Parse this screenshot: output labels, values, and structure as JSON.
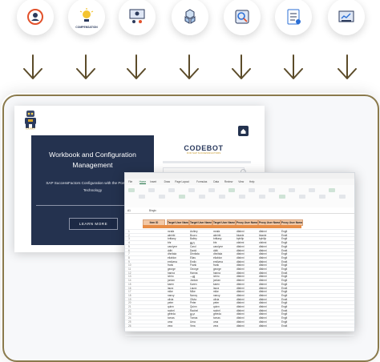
{
  "top_icons": [
    {
      "icon": "employee-profile-icon",
      "label": ""
    },
    {
      "icon": "compensation-icon",
      "label": "COMPENSATION"
    },
    {
      "icon": "team-management-icon",
      "label": ""
    },
    {
      "icon": "modules-cubes-icon",
      "label": ""
    },
    {
      "icon": "recruiting-search-icon",
      "label": ""
    },
    {
      "icon": "form-checklist-icon",
      "label": ""
    },
    {
      "icon": "analytics-dashboard-icon",
      "label": ""
    }
  ],
  "colors": {
    "navy": "#24324f",
    "gold": "#8a7a4c",
    "header_orange": "#f2c8a6",
    "excel_green": "#217346"
  },
  "card": {
    "title_line1": "Workbook and Configuration",
    "title_line2": "Management",
    "subtitle_line1": "SAP SuccessFactors Configuration with the Power of Bot",
    "subtitle_line2": "Technology",
    "button_label": "LEARN MORE"
  },
  "codebot": {
    "name": "CODEBOT",
    "tagline": "FOR SAP SUCCESSFACTORS"
  },
  "excel": {
    "tabs": [
      "File",
      "Home",
      "Insert",
      "Draw",
      "Page Layout",
      "Formulas",
      "Data",
      "Review",
      "View",
      "Help"
    ],
    "formula_ref": "A1",
    "formula_value": "Bingin",
    "headers": [
      "Item ID",
      "Target User Name",
      "Target User Name",
      "Target User Name",
      "Proxy User Name",
      "Proxy User Name",
      "Proxy User Name"
    ],
    "rows": [
      [
        "1",
        "mrafa",
        "Ashley",
        "mrafa",
        "dfahmi",
        "dfahmi",
        "Englt"
      ],
      [
        "2",
        "almirbi",
        "Bouru",
        "almirbi",
        "bkanie",
        "bkanie",
        "Englt"
      ],
      [
        "3",
        "brittany",
        "Bailey",
        "brittany",
        "bphilip",
        "bphilip",
        "Englt"
      ],
      [
        "4",
        "bhr",
        "暁介",
        "bhr",
        "cfahmi",
        "cfahmi",
        "Englt"
      ],
      [
        "5",
        "carolyne",
        "Carol",
        "carolyne",
        "dfahmi",
        "dfahmi",
        "Englt"
      ],
      [
        "6",
        "ddhi",
        "David",
        "ddhi",
        "dfahmi",
        "dfahmi",
        "Englt"
      ],
      [
        "7",
        "dhnitala",
        "Dhnitala",
        "dhnitala",
        "dfahmi",
        "dfahmi",
        "Englt"
      ],
      [
        "8",
        "eliablon",
        "Elias",
        "eliablon",
        "dfahmi",
        "dfahmi",
        "Englt"
      ],
      [
        "9",
        "emilyma",
        "Emily",
        "emilyma",
        "dfahmi",
        "dfahmi",
        "Englt"
      ],
      [
        "10",
        "frank",
        "Frank",
        "frank",
        "dfahmi",
        "dfahmi",
        "Englt"
      ],
      [
        "11",
        "george",
        "George",
        "george",
        "dfahmi",
        "dfahmi",
        "Englt"
      ],
      [
        "12",
        "hanna",
        "Hanna",
        "hanna",
        "dfahmi",
        "dfahmi",
        "Englt"
      ],
      [
        "13",
        "ichiro",
        "一郎",
        "ichiro",
        "dfahmi",
        "dfahmi",
        "Englt"
      ],
      [
        "14",
        "jordan",
        "Jordan",
        "jordan",
        "dfahmi",
        "dfahmi",
        "Englt"
      ],
      [
        "15",
        "karen",
        "Karen",
        "karen",
        "dfahmi",
        "dfahmi",
        "Englt"
      ],
      [
        "16",
        "laura",
        "Laura",
        "laura",
        "dfahmi",
        "dfahmi",
        "Englt"
      ],
      [
        "17",
        "mike",
        "Mike",
        "mike",
        "dfahmi",
        "dfahmi",
        "Englt"
      ],
      [
        "18",
        "nancy",
        "Nancy",
        "nancy",
        "dfahmi",
        "dfahmi",
        "Englt"
      ],
      [
        "19",
        "olivia",
        "Olivia",
        "olivia",
        "dfahmi",
        "dfahmi",
        "Englt"
      ],
      [
        "20",
        "peter",
        "Peter",
        "peter",
        "dfahmi",
        "dfahmi",
        "Englt"
      ],
      [
        "21",
        "quinn",
        "Quinn",
        "quinn",
        "dfahmi",
        "dfahmi",
        "Englt"
      ],
      [
        "22",
        "rachel",
        "Rachel",
        "rachel",
        "dfahmi",
        "dfahmi",
        "Englt"
      ],
      [
        "23",
        "gfrieda",
        "桜子",
        "gfrieda",
        "dfahmi",
        "dfahmi",
        "Englt"
      ],
      [
        "24",
        "tomas",
        "Tomas",
        "tomas",
        "dfahmi",
        "dfahmi",
        "Englt"
      ],
      [
        "25",
        "uma",
        "Uma",
        "uma",
        "dfahmi",
        "dfahmi",
        "Englt"
      ],
      [
        "26",
        "vera",
        "Vera",
        "vera",
        "dfahmi",
        "dfahmi",
        "Englt"
      ]
    ]
  }
}
